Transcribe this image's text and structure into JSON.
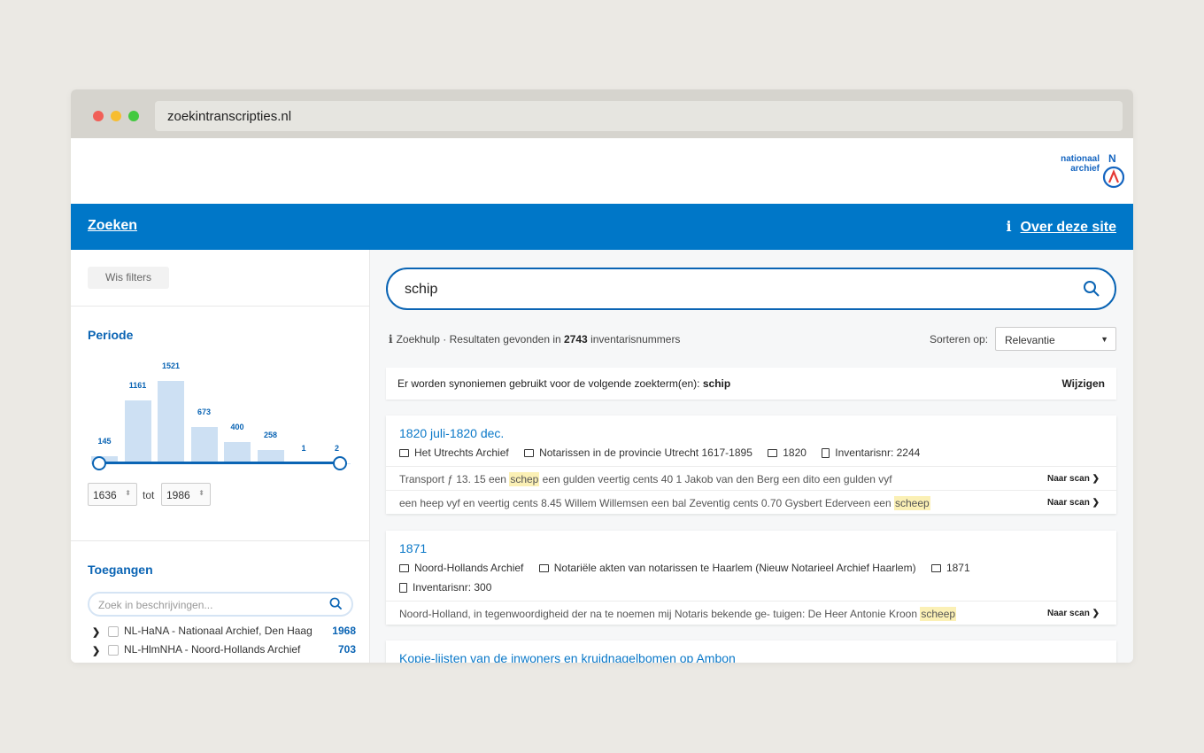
{
  "browser": {
    "url": "zoekintranscripties.nl"
  },
  "logo": {
    "line1": "nationaal",
    "line2": "archief",
    "mark": "N"
  },
  "nav": {
    "search": "Zoeken",
    "about": "Over deze site"
  },
  "sidebar": {
    "clear_filters": "Wis filters",
    "period_title": "Periode",
    "histogram": [
      {
        "label": "145",
        "value": 145
      },
      {
        "label": "1161",
        "value": 1161
      },
      {
        "label": "1521",
        "value": 1521
      },
      {
        "label": "673",
        "value": 673
      },
      {
        "label": "400",
        "value": 400
      },
      {
        "label": "258",
        "value": 258
      },
      {
        "label": "1",
        "value": 1
      },
      {
        "label": "2",
        "value": 2
      }
    ],
    "year_from": "1636",
    "year_to": "1986",
    "tot": "tot",
    "access_title": "Toegangen",
    "access_search_placeholder": "Zoek in beschrijvingen...",
    "access_items": [
      {
        "name": "NL-HaNA - Nationaal Archief, Den Haag",
        "count": "1968"
      },
      {
        "name": "NL-HlmNHA - Noord-Hollands Archief",
        "count": "703"
      }
    ]
  },
  "search": {
    "query": "schip"
  },
  "results_info": {
    "help": "Zoekhulp",
    "pre": " · Resultaten gevonden in ",
    "count": "2743",
    "post": " inventarisnummers"
  },
  "sort": {
    "label": "Sorteren op:",
    "value": "Relevantie"
  },
  "synonyms": {
    "text": "Er worden synoniemen gebruikt voor de volgende zoekterm(en): ",
    "term": "schip",
    "change": "Wijzigen"
  },
  "naar_scan": "Naar scan",
  "results": [
    {
      "title": "1820 juli-1820 dec.",
      "archive": "Het Utrechts Archief",
      "collection": "Notarissen in de provincie Utrecht 1617-1895",
      "year": "1820",
      "inventory": "Inventarisnr: 2244",
      "snippets": [
        {
          "pre": "Transport ƒ 13. 15 een ",
          "hl": "schep",
          "post": " een gulden veertig cents 40 1 Jakob van den Berg een dito een gulden vyf"
        },
        {
          "pre": "een heep vyf en veertig cents 8.45 Willem Willemsen een bal Zeventig cents 0.70 Gysbert Ederveen een ",
          "hl": "scheep",
          "post": ""
        }
      ]
    },
    {
      "title": "1871",
      "archive": "Noord-Hollands Archief",
      "collection": "Notariële akten van notarissen te Haarlem (Nieuw Notarieel Archief Haarlem)",
      "year": "1871",
      "inventory": "Inventarisnr: 300",
      "snippets": [
        {
          "pre": "Noord-Holland, in tegenwoordigheid der na te noemen mij Notaris bekende ge- tuigen: De Heer Antonie Kroon ",
          "hl": "scheep",
          "post": ""
        }
      ]
    },
    {
      "title": "Kopie-lijsten van de inwoners en kruidnagelbomen op Ambon"
    }
  ],
  "colors": {
    "brand_blue": "#0077c8",
    "link_blue": "#0a78c8",
    "highlight": "#fbf0b5",
    "bar": "#cde0f3"
  }
}
